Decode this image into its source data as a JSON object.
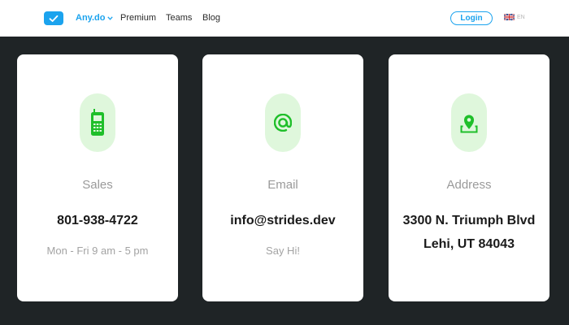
{
  "nav": {
    "logo_icon": "checkmark-icon",
    "brand": "Any.do",
    "premium": "Premium",
    "teams": "Teams",
    "blog": "Blog",
    "login": "Login",
    "lang_code": "EN"
  },
  "colors": {
    "accent": "#1ba3ee",
    "icon_green": "#1fbf2a",
    "icon_bg": "#dff7dc",
    "page_bg": "#1f2426"
  },
  "cards": [
    {
      "icon": "mobile-phone-icon",
      "title": "Sales",
      "value_lines": [
        "801-938-4722"
      ],
      "note": "Mon - Fri 9 am - 5 pm"
    },
    {
      "icon": "at-sign-icon",
      "title": "Email",
      "value_lines": [
        "info@strides.dev"
      ],
      "note": "Say Hi!"
    },
    {
      "icon": "map-pin-icon",
      "title": "Address",
      "value_lines": [
        "3300 N. Triumph Blvd",
        "Lehi, UT 84043"
      ],
      "note": ""
    }
  ]
}
